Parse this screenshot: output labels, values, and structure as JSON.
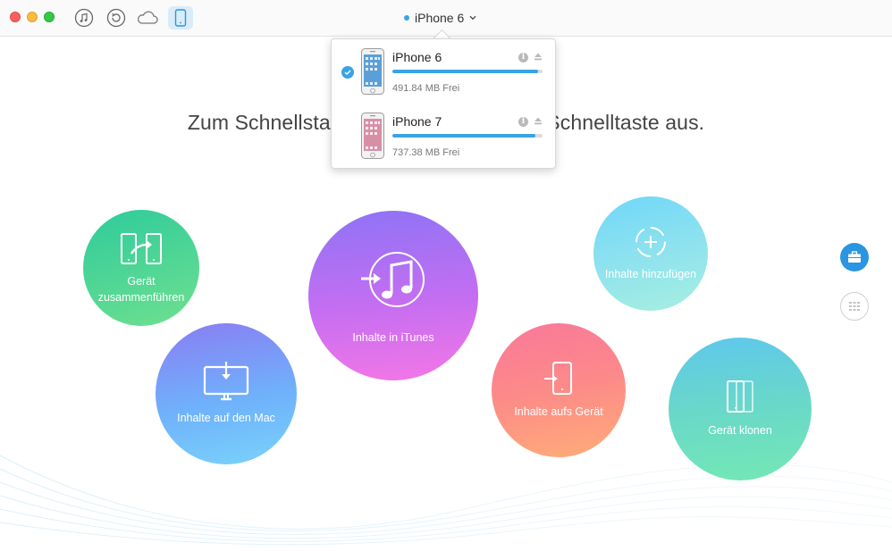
{
  "titlebar": {
    "device_title": "iPhone 6",
    "toolbar_icons": [
      "itunes-icon",
      "history-icon",
      "icloud-icon",
      "phone-icon"
    ]
  },
  "heading": "Zum Schnellstart wählen Sie bitte eine Schnelltaste aus.",
  "circles": {
    "merge": "Gerät\nzusammenführen",
    "mac": "Inhalte auf den Mac",
    "itunes": "Inhalte in iTunes",
    "device": "Inhalte aufs Gerät",
    "add": "Inhalte hinzufügen",
    "clone": "Gerät klonen"
  },
  "devices": [
    {
      "name": "iPhone 6",
      "free": "491.84 MB Frei",
      "storage_fraction": 0.97,
      "selected": true
    },
    {
      "name": "iPhone 7",
      "free": "737.38 MB Frei",
      "storage_fraction": 0.95,
      "selected": false
    }
  ],
  "colors": {
    "accent": "#3aa3e3",
    "traffic_close": "#fc605c",
    "traffic_min": "#fdbc40",
    "traffic_max": "#34c84a"
  }
}
